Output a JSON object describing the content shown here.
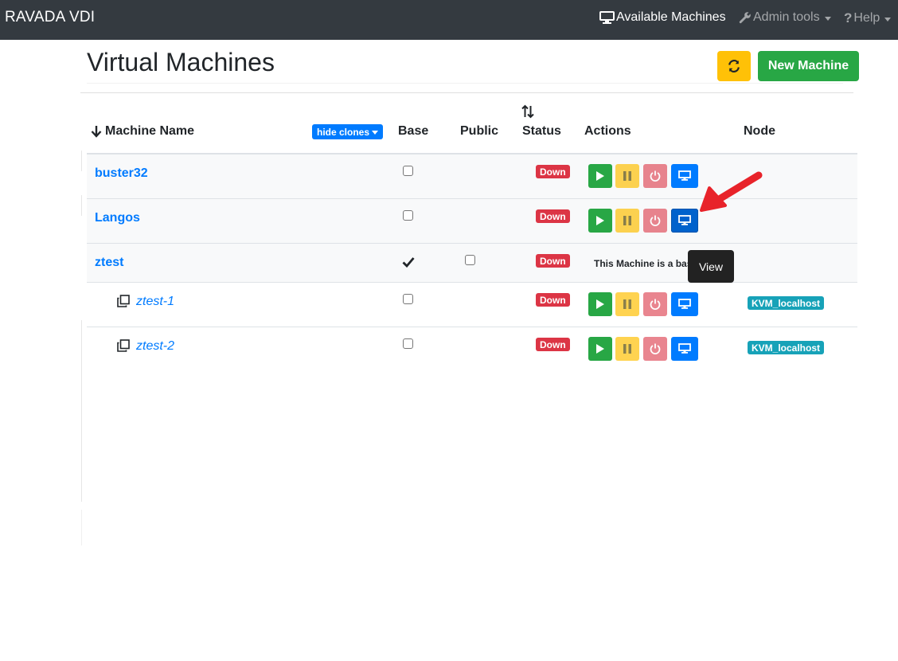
{
  "navbar": {
    "brand": "RAVADA VDI",
    "available_machines": "Available Machines",
    "admin_tools": "Admin tools",
    "help": "Help"
  },
  "page": {
    "title": "Virtual Machines",
    "new_machine": "New Machine",
    "hide_clones": "hide clones"
  },
  "table": {
    "headers": {
      "name": "Machine Name",
      "base": "Base",
      "public": "Public",
      "status": "Status",
      "actions": "Actions",
      "node": "Node"
    },
    "rows": [
      {
        "name": "buster32",
        "status": "Down"
      },
      {
        "name": "Langos",
        "status": "Down"
      },
      {
        "name": "ztest",
        "status": "Down",
        "base_message": "This Machine is a base"
      },
      {
        "name": "ztest-1",
        "status": "Down",
        "node": "KVM_localhost"
      },
      {
        "name": "ztest-2",
        "status": "Down",
        "node": "KVM_localhost"
      }
    ]
  },
  "tooltip": {
    "text": "View"
  },
  "colors": {
    "navbar": "#343a40",
    "primary": "#007bff",
    "success": "#28a745",
    "warning": "#ffc107",
    "danger": "#dc3545",
    "info": "#17a2b8",
    "annotation_arrow": "#e8232a"
  },
  "icons": {
    "nav_available": "desktop-icon",
    "nav_admin": "wrench-icon",
    "nav_help": "question-icon",
    "refresh": "refresh-icon",
    "sort": "arrow-down-icon",
    "status_sort": "sort-icon",
    "clone": "clone-icon",
    "start": "play-icon",
    "pause": "pause-icon",
    "shutdown": "power-icon",
    "view": "desktop-icon"
  }
}
